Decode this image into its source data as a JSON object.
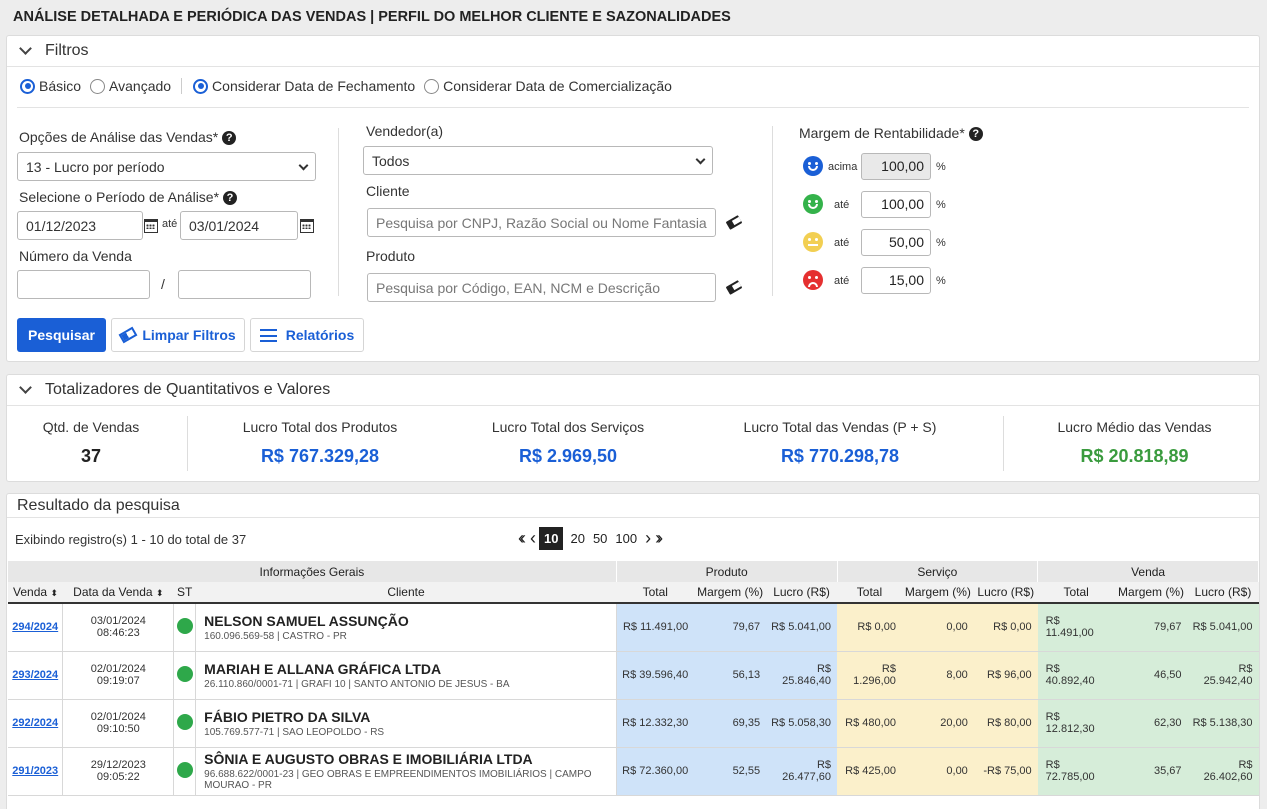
{
  "page_title": "ANÁLISE DETALHADA E PERIÓDICA DAS VENDAS | PERFIL DO MELHOR CLIENTE E SAZONALIDADES",
  "filters": {
    "title": "Filtros",
    "mode_basic": "Básico",
    "mode_advanced": "Avançado",
    "date_closing": "Considerar Data de Fechamento",
    "date_trading": "Considerar Data de Comercialização",
    "analysis_label": "Opções de Análise das Vendas*",
    "analysis_value": "13 - Lucro por período",
    "period_label": "Selecione o Período de Análise*",
    "date_from": "01/12/2023",
    "ate": "até",
    "date_to": "03/01/2024",
    "sale_number_label": "Número da Venda",
    "sale_from": "",
    "slash": "/",
    "sale_to": "",
    "seller_label": "Vendedor(a)",
    "seller_value": "Todos",
    "client_label": "Cliente",
    "client_placeholder": "Pesquisa por CNPJ, Razão Social ou Nome Fantasia",
    "product_label": "Produto",
    "product_placeholder": "Pesquisa por Código, EAN, NCM e Descrição",
    "margin_label": "Margem de Rentabilidade*",
    "margins": [
      {
        "label": "acima",
        "value": "100,00",
        "unit": "%"
      },
      {
        "label": "até",
        "value": "100,00",
        "unit": "%"
      },
      {
        "label": "até",
        "value": "50,00",
        "unit": "%"
      },
      {
        "label": "até",
        "value": "15,00",
        "unit": "%"
      }
    ],
    "btn_search": "Pesquisar",
    "btn_clear": "Limpar Filtros",
    "btn_reports": "Relatórios"
  },
  "totals": {
    "title": "Totalizadores de Quantitativos e Valores",
    "qty_label": "Qtd. de Vendas",
    "qty_value": "37",
    "prod_label": "Lucro Total dos Produtos",
    "prod_value": "R$ 767.329,28",
    "serv_label": "Lucro Total dos Serviços",
    "serv_value": "R$ 2.969,50",
    "sales_label": "Lucro Total das Vendas (P + S)",
    "sales_value": "R$ 770.298,78",
    "avg_label": "Lucro Médio das Vendas",
    "avg_value": "R$ 20.818,89"
  },
  "results": {
    "title": "Resultado da pesquisa",
    "showing": "Exibindo registro(s) 1 - 10 do total de 37",
    "page_sizes": [
      "10",
      "20",
      "50",
      "100"
    ],
    "groups": [
      "Informações Gerais",
      "Produto",
      "Serviço",
      "Venda"
    ],
    "columns": [
      "Venda",
      "Data da Venda",
      "ST",
      "Cliente",
      "Total",
      "Margem (%)",
      "Lucro (R$)",
      "Total",
      "Margem (%)",
      "Lucro (R$)",
      "Total",
      "Margem (%)",
      "Lucro (R$)"
    ],
    "rows": [
      {
        "venda": "294/2024",
        "date": "03/01/2024",
        "time": "08:46:23",
        "client": "NELSON SAMUEL ASSUNÇÃO",
        "sub": "160.096.569-58 | CASTRO - PR",
        "p_total": "R$ 11.491,00",
        "p_margin": "79,67",
        "p_profit": "R$ 5.041,00",
        "s_total": "R$ 0,00",
        "s_margin": "0,00",
        "s_profit": "R$ 0,00",
        "v_total": "R$ 11.491,00",
        "v_margin": "79,67",
        "v_profit": "R$ 5.041,00"
      },
      {
        "venda": "293/2024",
        "date": "02/01/2024",
        "time": "09:19:07",
        "client": "MARIAH E ALLANA GRÁFICA LTDA",
        "sub": "26.110.860/0001-71 | GRAFI 10 | SANTO ANTONIO DE JESUS - BA",
        "p_total": "R$ 39.596,40",
        "p_margin": "56,13",
        "p_profit": "R$ 25.846,40",
        "s_total": "R$ 1.296,00",
        "s_margin": "8,00",
        "s_profit": "R$ 96,00",
        "v_total": "R$ 40.892,40",
        "v_margin": "46,50",
        "v_profit": "R$ 25.942,40"
      },
      {
        "venda": "292/2024",
        "date": "02/01/2024",
        "time": "09:10:50",
        "client": "FÁBIO PIETRO DA SILVA",
        "sub": "105.769.577-71 | SAO LEOPOLDO - RS",
        "p_total": "R$ 12.332,30",
        "p_margin": "69,35",
        "p_profit": "R$ 5.058,30",
        "s_total": "R$ 480,00",
        "s_margin": "20,00",
        "s_profit": "R$ 80,00",
        "v_total": "R$ 12.812,30",
        "v_margin": "62,30",
        "v_profit": "R$ 5.138,30"
      },
      {
        "venda": "291/2023",
        "date": "29/12/2023",
        "time": "09:05:22",
        "client": "SÔNIA E AUGUSTO OBRAS E IMOBILIÁRIA LTDA",
        "sub": "96.688.622/0001-23 | GEO OBRAS E EMPREENDIMENTOS IMOBILIÁRIOS | CAMPO MOURAO - PR",
        "p_total": "R$ 72.360,00",
        "p_margin": "52,55",
        "p_profit": "R$ 26.477,60",
        "s_total": "R$ 425,00",
        "s_margin": "0,00",
        "s_profit": "-R$ 75,00",
        "v_total": "R$ 72.785,00",
        "v_margin": "35,67",
        "v_profit": "R$ 26.402,60"
      }
    ]
  },
  "colors": {
    "primary": "#1a5fd6",
    "product_bg": "#cfe3f9",
    "service_bg": "#fbf0cb",
    "sale_bg": "#d6edd9",
    "status_ok": "#2ea84a",
    "profit_green": "#3a9b3e"
  }
}
